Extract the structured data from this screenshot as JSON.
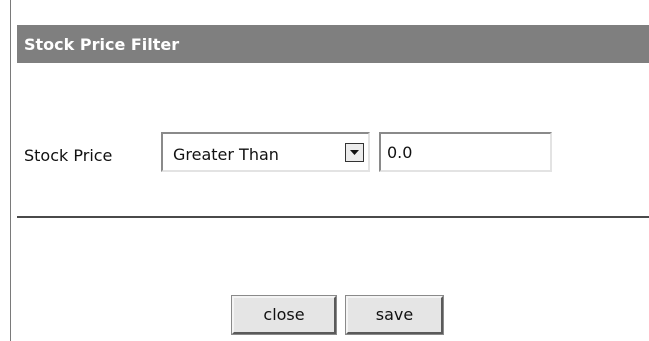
{
  "dialog": {
    "title": "Stock Price Filter"
  },
  "filter": {
    "label": "Stock Price",
    "operator_selected": "Greater Than",
    "value": "0.0"
  },
  "buttons": {
    "close_label": "close",
    "save_label": "save"
  },
  "icons": {
    "dropdown": "chevron-down-icon"
  },
  "colors": {
    "title_bar": "#7f7f7f",
    "title_text": "#ffffff"
  }
}
